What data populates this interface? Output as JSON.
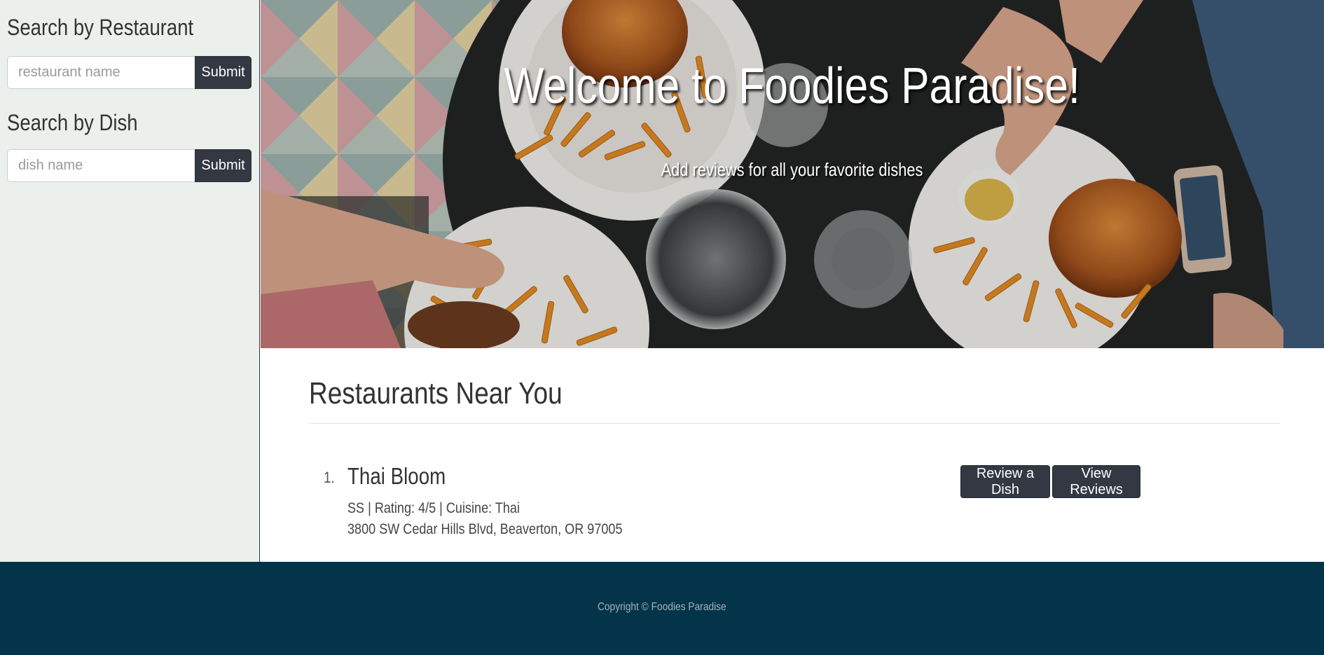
{
  "sidebar": {
    "restaurant_heading": "Search by Restaurant",
    "restaurant_placeholder": "restaurant name",
    "restaurant_submit": "Submit",
    "dish_heading": "Search by Dish",
    "dish_placeholder": "dish name",
    "dish_submit": "Submit"
  },
  "hero": {
    "title": "Welcome to Foodies Paradise!",
    "subtitle": "Add reviews for all your favorite dishes"
  },
  "main": {
    "section_title": "Restaurants Near You",
    "restaurants": [
      {
        "number": "1.",
        "name": "Thai Bloom",
        "meta": "SS | Rating: 4/5 | Cuisine: Thai",
        "address": "3800 SW Cedar Hills Blvd, Beaverton, OR 97005",
        "review_button": "Review a Dish",
        "view_button": "View Reviews"
      }
    ]
  },
  "footer": {
    "copyright": "Copyright © Foodies Paradise"
  },
  "colors": {
    "sidebar_bg": "#ecf0ec",
    "button_dark": "#333842",
    "footer_bg": "#03344a"
  }
}
